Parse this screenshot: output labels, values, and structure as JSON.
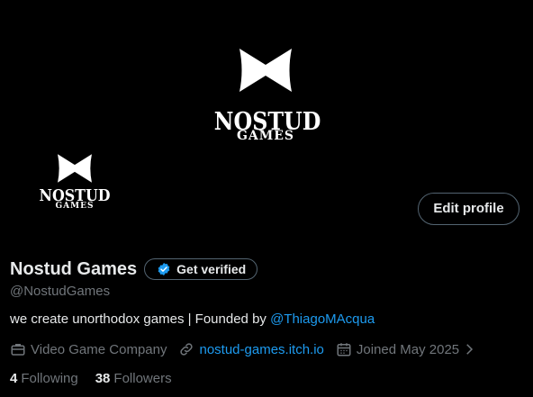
{
  "banner": {
    "logo_word": "NOSTUD",
    "logo_sub": "GAMES"
  },
  "avatar": {
    "logo_word": "NOSTUD",
    "logo_sub": "GAMES"
  },
  "actions": {
    "edit_profile": "Edit profile"
  },
  "profile": {
    "display_name": "Nostud Games",
    "get_verified": "Get verified",
    "handle": "@NostudGames",
    "bio_text": "we create unorthodox games | Founded by ",
    "bio_mention": "@ThiagoMAcqua"
  },
  "meta": {
    "category": "Video Game Company",
    "website": "nostud-games.itch.io",
    "joined": "Joined May 2025"
  },
  "stats": {
    "following_count": "4",
    "following_label": "Following",
    "followers_count": "38",
    "followers_label": "Followers"
  },
  "colors": {
    "background": "#000000",
    "accent": "#1d9bf0",
    "muted": "#71767b",
    "text": "#e7e9ea",
    "border": "#536471"
  },
  "icons": [
    "bowtie-logo-icon",
    "verified-badge-icon",
    "briefcase-icon",
    "link-icon",
    "calendar-icon",
    "chevron-right-icon"
  ]
}
